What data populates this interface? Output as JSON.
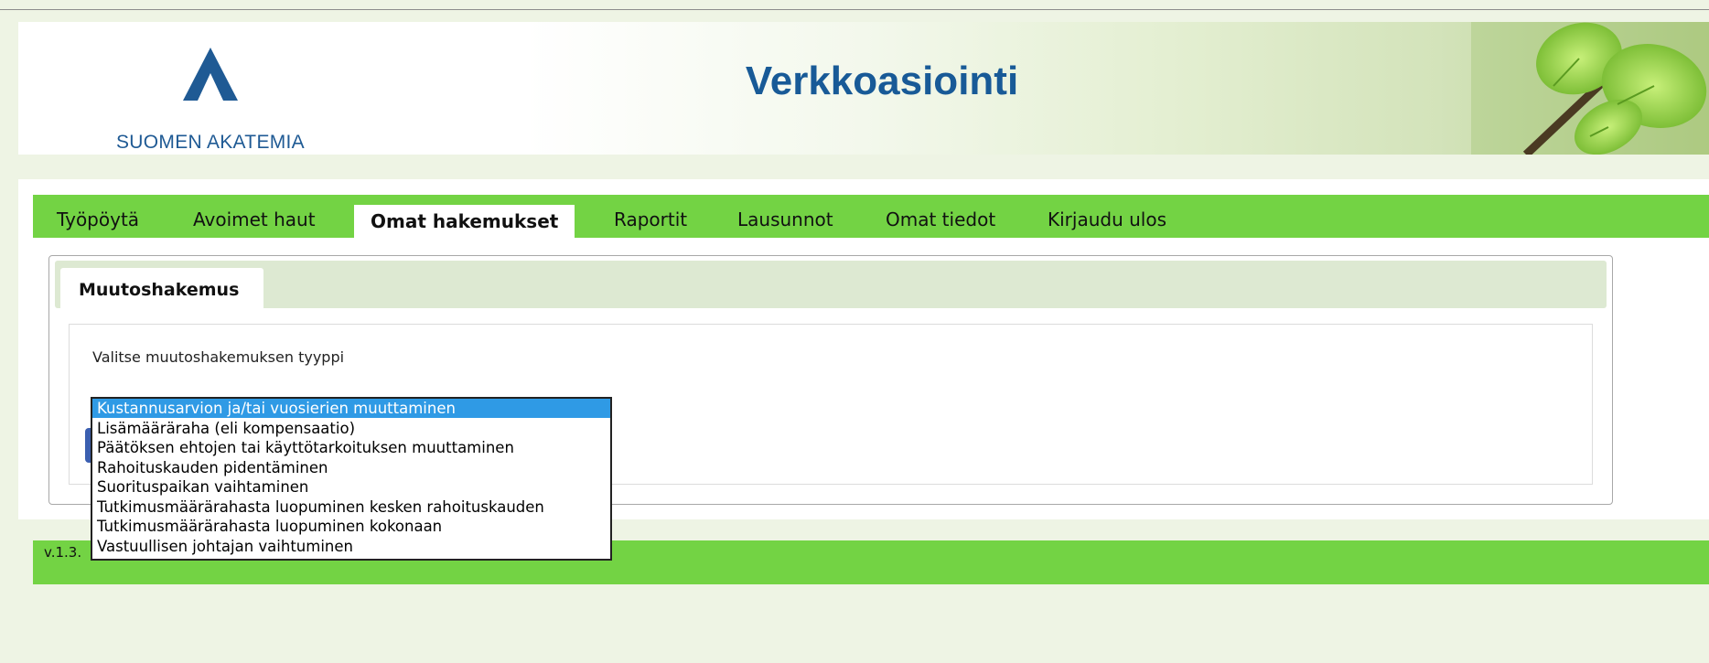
{
  "header": {
    "logo_text": "SUOMEN AKATEMIA",
    "title": "Verkkoasiointi"
  },
  "nav": {
    "items": [
      {
        "label": "Työpöytä"
      },
      {
        "label": "Avoimet haut"
      },
      {
        "label": "Omat hakemukset",
        "active": true
      },
      {
        "label": "Raportit"
      },
      {
        "label": "Lausunnot"
      },
      {
        "label": "Omat tiedot"
      },
      {
        "label": "Kirjaudu ulos"
      }
    ]
  },
  "form": {
    "tab_label": "Muutoshakemus",
    "field_label": "Valitse muutoshakemuksen tyyppi"
  },
  "dropdown": {
    "selected_index": 0,
    "options": [
      "Kustannusarvion ja/tai vuosierien muuttaminen",
      "Lisämääräraha (eli kompensaatio)",
      "Päätöksen ehtojen tai käyttötarkoituksen muuttaminen",
      "Rahoituskauden pidentäminen",
      "Suorituspaikan vaihtaminen",
      "Tutkimusmäärärahasta luopuminen kesken rahoituskauden",
      "Tutkimusmäärärahasta luopuminen kokonaan",
      "Vastuullisen johtajan vaihtuminen"
    ]
  },
  "footer": {
    "version_text": "v.1.3."
  },
  "colors": {
    "nav_green": "#73d344",
    "title_blue": "#185a97",
    "selection_blue": "#2f9ae5",
    "page_background": "#eef4e4"
  }
}
